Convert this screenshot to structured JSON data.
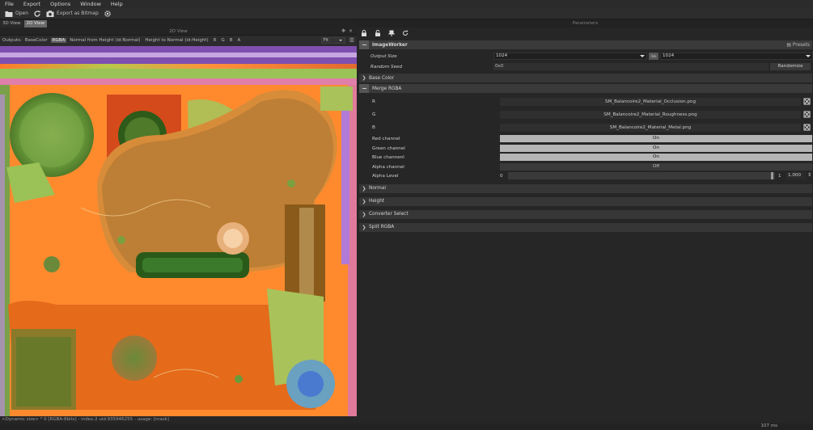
{
  "menu": [
    "File",
    "Export",
    "Options",
    "Window",
    "Help"
  ],
  "toolbar": {
    "open_label": "Open",
    "export_label": "Export as Bitmap"
  },
  "tabs": [
    "3D View",
    "2D View"
  ],
  "view": {
    "title": "2D View",
    "outputs_label": "Outputs:",
    "outputs": [
      "BaseColor",
      "RGBA",
      "Normal from Height (id:Normal)",
      "Height to Normal (id:Height)",
      "R",
      "G",
      "B",
      "A"
    ],
    "selected_output": "RGBA",
    "fit_value": "Fit",
    "status": "<Dynamic size> * 0 [RGBA-8bits] - index:2 uid:935946255 - usage: [mask]"
  },
  "params": {
    "title": "Parameters",
    "worker": "ImageWorker",
    "presets": "Presets",
    "output_size_label": "Output Size",
    "output_size_1": "1024",
    "output_size_2": "1024",
    "link_icon_text": "link",
    "random_seed_label": "Random Seed",
    "random_seed": "0x0",
    "randomize": "Randomize",
    "merge_title": "Merge RGBA",
    "files": [
      {
        "label": "R",
        "value": "SM_Balancoire2_Material_Occlusion.png"
      },
      {
        "label": "G",
        "value": "SM_Balancoire2_Material_Roughness.png"
      },
      {
        "label": "B",
        "value": "SM_Balancoire2_Material_Metal.png"
      }
    ],
    "toggles": [
      {
        "label": "Red channel",
        "value": "On"
      },
      {
        "label": "Green channel",
        "value": "On"
      },
      {
        "label": "Blue channenl",
        "value": "On"
      },
      {
        "label": "Alpha channel",
        "value": "Off"
      }
    ],
    "alpha_label": "Alpha Level",
    "alpha_min": "0",
    "alpha_max": "1",
    "alpha_value": "1.000",
    "sections": [
      "Base Color",
      "Normal",
      "Height",
      "Converter Select",
      "Split RGBA"
    ]
  },
  "footer": {
    "time": "107 ms"
  },
  "colors": {
    "accent_on": "#b5b5b5",
    "panel": "#262626",
    "header": "#3a3a3a"
  }
}
